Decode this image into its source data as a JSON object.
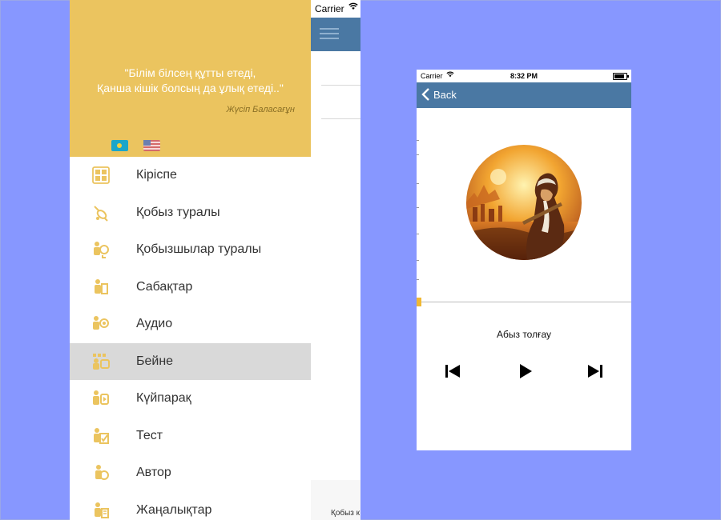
{
  "left_screen": {
    "status": {
      "carrier": "Carrier"
    },
    "drawer": {
      "quote": "\"Білім білсең құтты етеді,\nҚанша кішік болсың да ұлық етеді..\"",
      "author": "Жүсіп Баласағұн",
      "languages": [
        "kazakh-flag",
        "us-flag"
      ],
      "items": [
        {
          "label": "Кіріспе",
          "icon": "grid-icon"
        },
        {
          "label": "Қобыз туралы",
          "icon": "kobyz-instrument-icon"
        },
        {
          "label": "Қобызшылар туралы",
          "icon": "performer-icon"
        },
        {
          "label": "Сабақтар",
          "icon": "lessons-icon"
        },
        {
          "label": "Аудио",
          "icon": "audio-icon"
        },
        {
          "label": "Бейне",
          "icon": "video-icon",
          "active": true
        },
        {
          "label": "Күйпарақ",
          "icon": "sheet-music-icon"
        },
        {
          "label": "Тест",
          "icon": "test-icon"
        },
        {
          "label": "Автор",
          "icon": "author-icon"
        },
        {
          "label": "Жаңалықтар",
          "icon": "news-icon"
        }
      ]
    },
    "background_footer_text": "Қобыз к"
  },
  "right_screen": {
    "status": {
      "carrier": "Carrier",
      "time": "8:32 PM"
    },
    "nav": {
      "back_label": "Back"
    },
    "player": {
      "track_title": "Абыз толғау",
      "progress": 0.0
    }
  },
  "colors": {
    "background": "#8797ff",
    "drawer_header": "#ebc45f",
    "nav_blue": "#4a78a3",
    "icon_gold": "#ebc45f",
    "active_row": "#d9d9d9",
    "progress_knob": "#f0b833"
  }
}
